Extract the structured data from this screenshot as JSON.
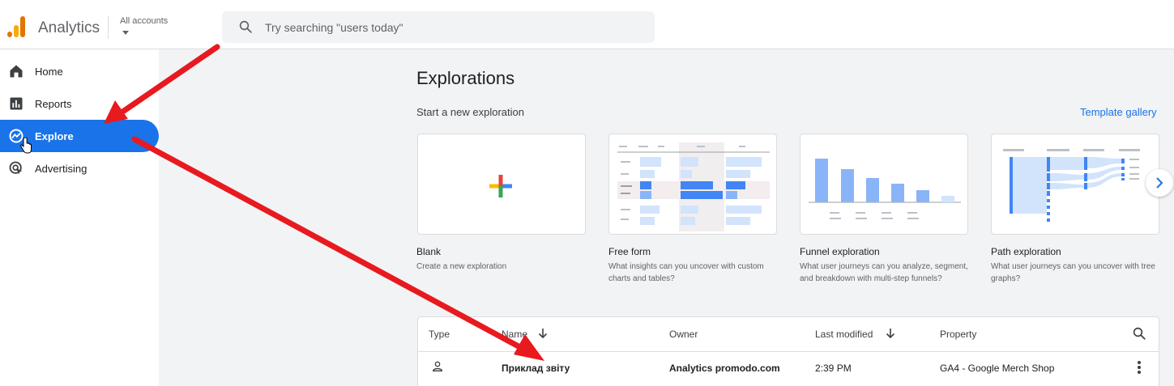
{
  "header": {
    "app_title": "Analytics",
    "account_label": "All accounts",
    "search_placeholder": "Try searching \"users today\""
  },
  "sidebar": {
    "items": [
      {
        "label": "Home",
        "icon": "home-icon"
      },
      {
        "label": "Reports",
        "icon": "bar-chart-icon"
      },
      {
        "label": "Explore",
        "icon": "explore-icon",
        "active": true
      },
      {
        "label": "Advertising",
        "icon": "advertising-icon"
      }
    ]
  },
  "main": {
    "title": "Explorations",
    "subtitle": "Start a new exploration",
    "gallery_link": "Template gallery",
    "templates": [
      {
        "name": "Blank",
        "description": "Create a new exploration"
      },
      {
        "name": "Free form",
        "description": "What insights can you uncover with custom charts and tables?"
      },
      {
        "name": "Funnel exploration",
        "description": "What user journeys can you analyze, segment, and breakdown with multi-step funnels?"
      },
      {
        "name": "Path exploration",
        "description": "What user journeys can you uncover with tree graphs?"
      }
    ]
  },
  "table": {
    "columns": {
      "type": "Type",
      "name": "Name",
      "owner": "Owner",
      "last_modified": "Last modified",
      "property": "Property"
    },
    "rows": [
      {
        "name": "Приклад звіту",
        "owner": "Analytics promodo.com",
        "last_modified": "2:39 PM",
        "property": "GA4 - Google Merch Shop"
      }
    ]
  },
  "colors": {
    "accent": "#1a73e8",
    "annotation_arrow": "#e8191f"
  }
}
